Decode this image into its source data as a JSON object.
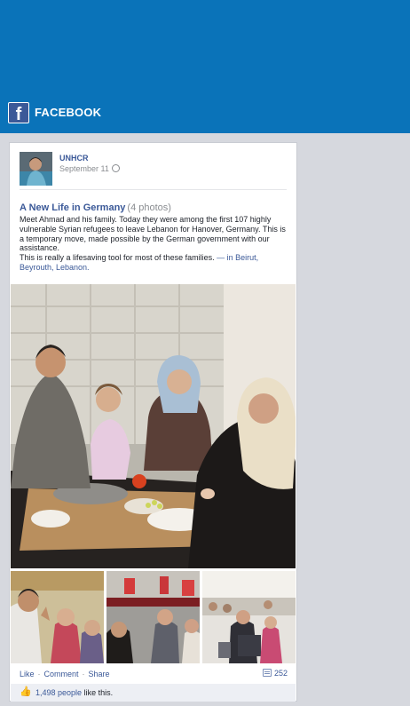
{
  "app": {
    "header_brand": "FACEBOOK",
    "logo_letter": "f",
    "header_color": "#0a73b9"
  },
  "post": {
    "author": "UNHCR",
    "date": "September 11",
    "privacy_icon": "globe-icon",
    "album_title": "A New Life in Germany",
    "album_count": "(4 photos)",
    "message": "Meet Ahmad and his family. Today they were among the first 107 highly vulnerable Syrian refugees to leave Lebanon for Hanover, Germany. This is a temporary move, made possible by the German government with our assistance.",
    "message_2": "This is really a lifesaving tool for most of these families.",
    "location_prefix": "— in",
    "location": "Beirut, Beyrouth, Lebanon."
  },
  "actions": {
    "like": "Like",
    "comment": "Comment",
    "share": "Share",
    "separator": "·",
    "comment_count": "252"
  },
  "likes": {
    "count_label": "1,498 people",
    "suffix": "like this."
  }
}
